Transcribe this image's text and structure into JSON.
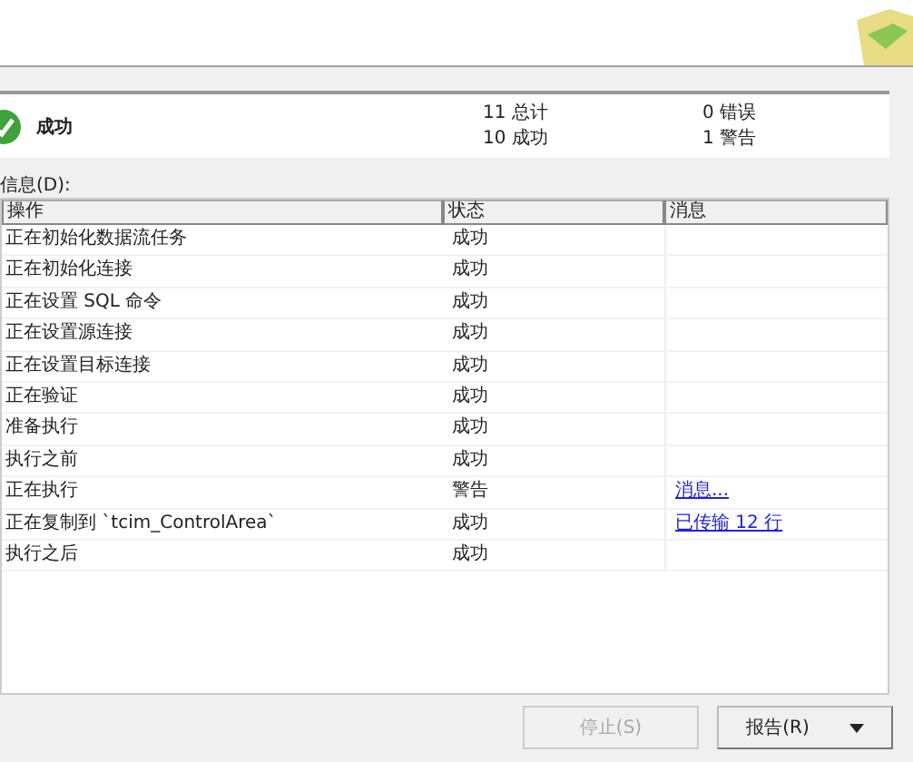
{
  "summary": {
    "status": "成功",
    "counts": [
      "11 总计",
      "0 错误",
      "10 成功",
      "1 警告"
    ]
  },
  "details_label": "信息(D):",
  "table": {
    "columns": [
      "操作",
      "状态",
      "消息"
    ],
    "rows": [
      {
        "action": "正在初始化数据流任务",
        "status": "成功"
      },
      {
        "action": "正在初始化连接",
        "status": "成功"
      },
      {
        "action": "正在设置 SQL 命令",
        "status": "成功"
      },
      {
        "action": "正在设置源连接",
        "status": "成功"
      },
      {
        "action": "正在设置目标连接",
        "status": "成功"
      },
      {
        "action": "正在验证",
        "status": "成功"
      },
      {
        "action": "准备执行",
        "status": "成功"
      },
      {
        "action": "执行之前",
        "status": "成功"
      },
      {
        "action": "正在执行",
        "status": "警告",
        "message": "消息..."
      },
      {
        "action": "正在复制到 `tcim_ControlArea`",
        "status": "成功",
        "message": "已传输 12 行"
      },
      {
        "action": "执行之后",
        "status": "成功"
      }
    ]
  },
  "buttons": [
    {
      "label": "停止(S)",
      "disabled": true,
      "dropdown": false
    },
    {
      "label": "报告(R)",
      "disabled": false,
      "dropdown": true
    }
  ]
}
